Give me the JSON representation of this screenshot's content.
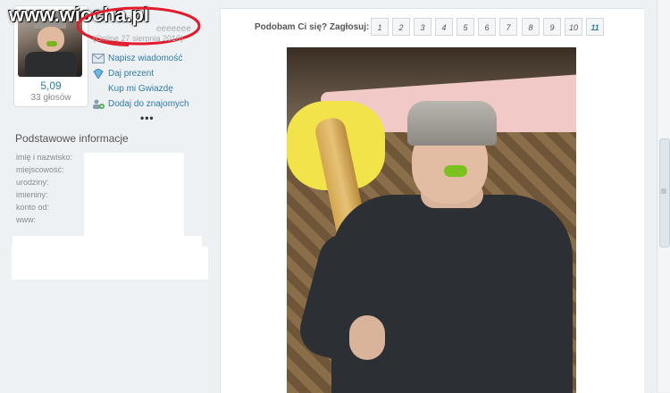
{
  "site": {
    "logo": "www.wiocha.pl"
  },
  "profile": {
    "name_fragment": "eeeeeee",
    "online_status": "(Online 27 sierpnia 2010)",
    "rating": "5,09",
    "votes": "33 głosów",
    "more": "•••"
  },
  "actions": [
    {
      "label": "Napisz wiadomość",
      "icon": "envelope-icon"
    },
    {
      "label": "Daj prezent",
      "icon": "gift-icon"
    },
    {
      "label": "Kup mi Gwiazdę",
      "icon": ""
    },
    {
      "label": "Dodaj do znajomych",
      "icon": "add-friend-icon"
    }
  ],
  "info": {
    "title": "Podstawowe informacje",
    "labels": [
      "imię i nazwisko:",
      "miejscowość:",
      "urodziny:",
      "imieniny:",
      "konto od:",
      "www:"
    ]
  },
  "voting": {
    "label": "Podobam Ci się? Zagłosuj:",
    "options": [
      "1",
      "2",
      "3",
      "4",
      "5",
      "6",
      "7",
      "8",
      "9",
      "10",
      "11"
    ],
    "highlighted": "11"
  },
  "colors": {
    "accent": "#2f7ba6",
    "background": "#eef1f4",
    "highlight_ring": "#e11d2d"
  }
}
